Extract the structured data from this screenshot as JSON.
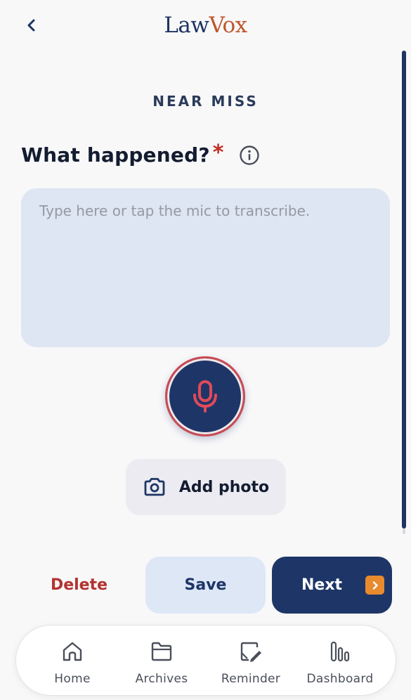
{
  "header": {
    "logo_part1": "Law",
    "logo_part2": "Vox"
  },
  "form": {
    "section_title": "NEAR MISS",
    "question": "What happened?",
    "required_marker": "*",
    "textarea_placeholder": "Type here or tap the mic to transcribe.",
    "textarea_value": ""
  },
  "photo": {
    "label": "Add photo"
  },
  "actions": {
    "delete_label": "Delete",
    "save_label": "Save",
    "next_label": "Next"
  },
  "nav": {
    "items": [
      {
        "label": "Home",
        "icon": "home-icon"
      },
      {
        "label": "Archives",
        "icon": "folder-icon"
      },
      {
        "label": "Reminder",
        "icon": "note-edit-icon"
      },
      {
        "label": "Dashboard",
        "icon": "bar-chart-icon"
      }
    ]
  },
  "colors": {
    "brand_navy": "#1e3667",
    "brand_orange": "#c0562b",
    "accent_red": "#c22f24",
    "next_arrow": "#e88a2e"
  }
}
